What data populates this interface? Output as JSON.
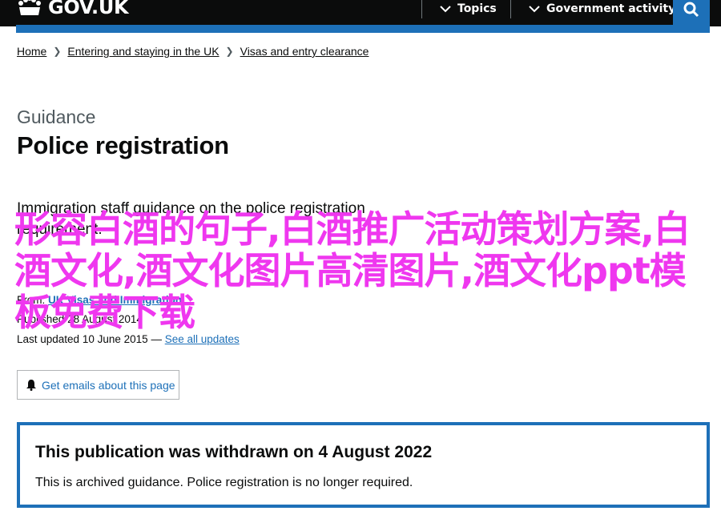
{
  "header": {
    "logo_text": "GOV.UK",
    "nav": [
      {
        "label": "Topics"
      },
      {
        "label": "Government activity"
      }
    ]
  },
  "breadcrumbs": [
    "Home",
    "Entering and staying in the UK",
    "Visas and entry clearance"
  ],
  "page": {
    "caption": "Guidance",
    "title": "Police registration",
    "lead": "Immigration staff guidance on the police registration requirement."
  },
  "meta": {
    "from_label": "From:",
    "from_link": "UK Visas and Immigration",
    "published_label": "Published",
    "published_date": "28 August 2014",
    "updated_label": "Last updated",
    "updated_date": "10 June 2015",
    "updated_sep": "—",
    "see_all_updates": "See all updates"
  },
  "overlay_text": "形容白酒的句子,白酒推广活动策划方案,白酒文化,酒文化图片高清图片,酒文化ppt模板免费下载",
  "email_button": "Get emails about this page",
  "withdrawn": {
    "heading": "This publication was withdrawn on 4 August 2022",
    "body": "This is archived guidance. Police registration is no longer required."
  },
  "colors": {
    "header_bg": "#0b0c0c",
    "link": "#1d70b8",
    "overlay": "#ef37ef"
  }
}
